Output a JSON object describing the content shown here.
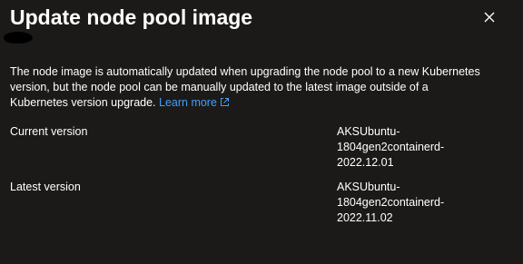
{
  "panel": {
    "title": "Update node pool image",
    "close_icon": "close-icon"
  },
  "description": {
    "text": "The node image is automatically updated when upgrading the node pool to a new Kubernetes version, but the node pool can be manually updated to the latest image outside of a Kubernetes version upgrade. ",
    "link_label": "Learn more",
    "link_icon": "external-link-icon",
    "link_color": "#479ef5"
  },
  "details": {
    "current_version": {
      "label": "Current version",
      "value_lines": [
        "AKSUbuntu-",
        "1804gen2containerd-",
        "2022.12.01"
      ]
    },
    "latest_version": {
      "label": "Latest version",
      "value_lines": [
        "AKSUbuntu-",
        "1804gen2containerd-",
        "2022.11.02"
      ]
    }
  }
}
